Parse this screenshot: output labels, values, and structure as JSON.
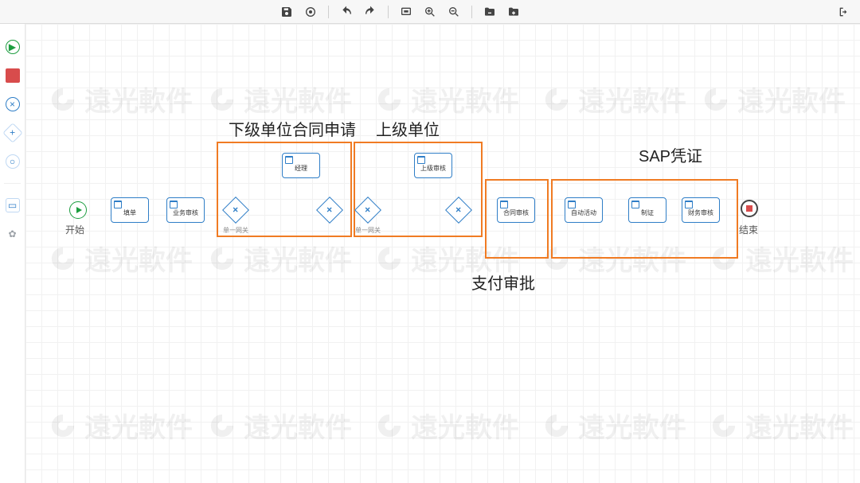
{
  "toolbar": {
    "save_icon": "save",
    "target_icon": "target",
    "undo_icon": "undo",
    "redo_icon": "redo",
    "fit_icon": "fit-screen",
    "zoom_in_icon": "zoom-in",
    "zoom_out_icon": "zoom-out",
    "folder_open_icon": "folder-open",
    "folder_add_icon": "folder-add",
    "exit_icon": "exit"
  },
  "palette": {
    "start": "start-event",
    "end": "end-event",
    "cancel": "cancel",
    "gateway": "gateway",
    "subprocess": "subprocess",
    "document": "document",
    "settings": "settings"
  },
  "annotations": {
    "lower_unit": "下级单位合同申请",
    "upper_unit": "上级单位",
    "pay_approve": "支付审批",
    "sap_voucher": "SAP凭证"
  },
  "nodes": {
    "start": {
      "label": "开始"
    },
    "fill_form": {
      "label": "填单"
    },
    "biz_review": {
      "label": "业务审核"
    },
    "gw1": {
      "label": "单一网关",
      "symbol": "×"
    },
    "manager": {
      "label": "经理"
    },
    "gw2": {
      "symbol": "×"
    },
    "gw3": {
      "label": "单一网关",
      "symbol": "×"
    },
    "superior_review": {
      "label": "上级审核"
    },
    "gw4": {
      "symbol": "×"
    },
    "contract_review": {
      "label": "合同审核"
    },
    "auto_activity": {
      "label": "自动活动"
    },
    "voucher": {
      "label": "制证"
    },
    "finance_review": {
      "label": "财务审核"
    },
    "end": {
      "label": "结束"
    }
  },
  "watermark_text": "遠光軟件"
}
